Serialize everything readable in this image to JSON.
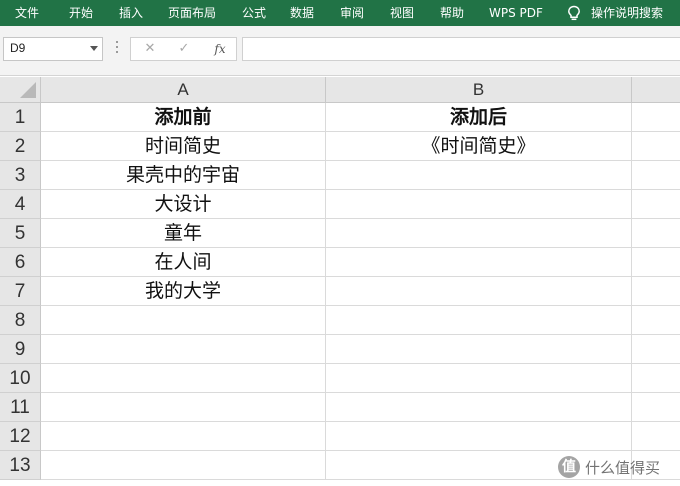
{
  "ribbon": {
    "tabs": [
      "文件",
      "开始",
      "插入",
      "页面布局",
      "公式",
      "数据",
      "审阅",
      "视图",
      "帮助",
      "WPS PDF"
    ],
    "search_label": "操作说明搜索",
    "background": "#217346"
  },
  "formula_bar": {
    "name_box": "D9",
    "cancel_symbol": "✕",
    "enter_symbol": "✓",
    "fx_label": "fx",
    "formula": ""
  },
  "sheet": {
    "columns": [
      "A",
      "B"
    ],
    "rows": [
      "1",
      "2",
      "3",
      "4",
      "5",
      "6",
      "7",
      "8",
      "9",
      "10",
      "11",
      "12",
      "13"
    ],
    "cells": {
      "a1": "添加前",
      "b1": "添加后",
      "a2": "时间简史",
      "b2": "《时间简史》",
      "a3": "果壳中的宇宙",
      "a4": "大设计",
      "a5": "童年",
      "a6": "在人间",
      "a7": "我的大学"
    }
  },
  "watermark": {
    "badge": "值",
    "text": "什么值得买"
  }
}
